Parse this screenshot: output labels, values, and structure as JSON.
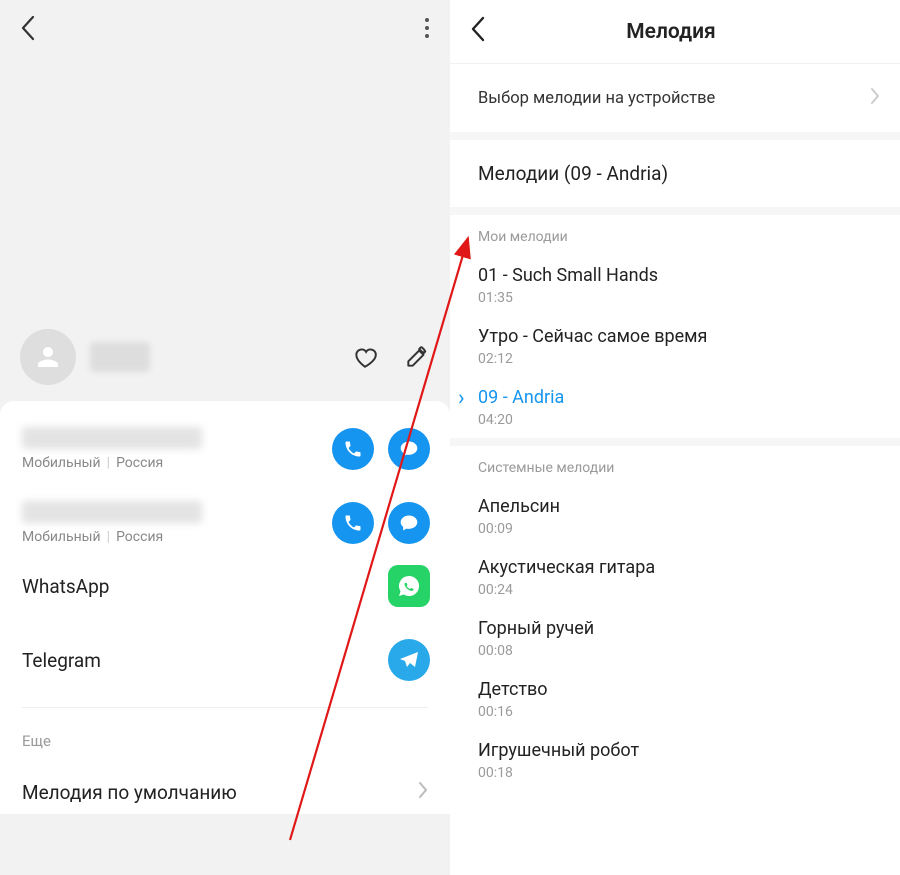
{
  "left": {
    "contact_meta_type": "Мобильный",
    "contact_meta_region": "Россия",
    "apps": {
      "whatsapp": "WhatsApp",
      "telegram": "Telegram"
    },
    "more_section": "Еще",
    "default_ringtone": "Мелодия по умолчанию"
  },
  "right": {
    "title": "Мелодия",
    "picker": "Выбор мелодии на устройстве",
    "current": "Мелодии (09 - Andria)",
    "groups": {
      "my": "Мои мелодии",
      "system": "Системные мелодии"
    },
    "my_ringtones": [
      {
        "title": "01 - Such Small Hands",
        "time": "01:35",
        "selected": false
      },
      {
        "title": "Утро - Сейчас самое время",
        "time": "02:12",
        "selected": false
      },
      {
        "title": "09 - Andria",
        "time": "04:20",
        "selected": true
      }
    ],
    "system_ringtones": [
      {
        "title": "Апельсин",
        "time": "00:09"
      },
      {
        "title": "Акустическая гитара",
        "time": "00:24"
      },
      {
        "title": "Горный ручей",
        "time": "00:08"
      },
      {
        "title": "Детство",
        "time": "00:16"
      },
      {
        "title": "Игрушечный робот",
        "time": "00:18"
      }
    ]
  }
}
